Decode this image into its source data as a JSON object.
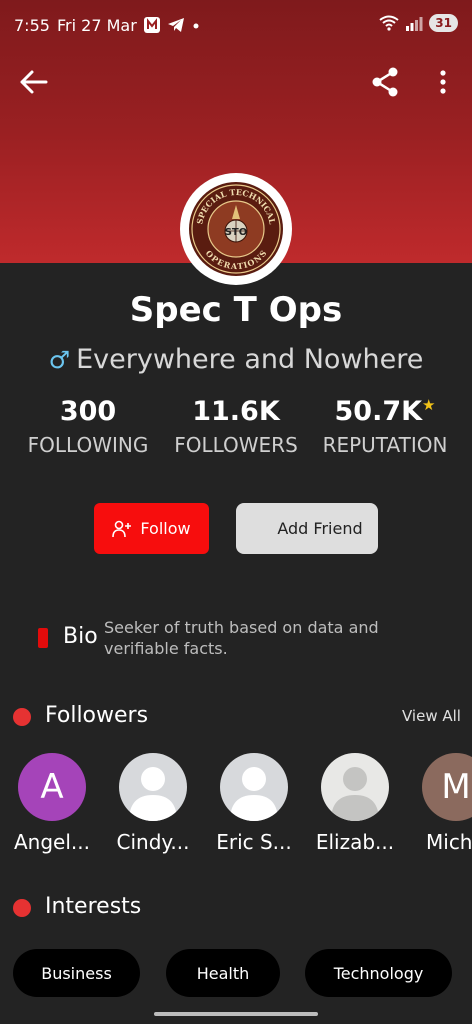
{
  "status_bar": {
    "time": "7:55",
    "date": "Fri 27 Mar",
    "battery": "31"
  },
  "header": {
    "back_icon": "arrow-left-icon",
    "share_icon": "share-icon",
    "more_icon": "more-vertical-icon"
  },
  "profile": {
    "logo_text_top": "SPECIAL TECHNICAL",
    "logo_text_bottom": "OPERATIONS",
    "logo_center": "STO",
    "name": "Spec T Ops",
    "gender_symbol": "♂",
    "location": "Everywhere and Nowhere"
  },
  "stats": [
    {
      "value": "300",
      "label": "FOLLOWING"
    },
    {
      "value": "11.6K",
      "label": "FOLLOWERS"
    },
    {
      "value": "50.7K",
      "label": "REPUTATION"
    }
  ],
  "actions": {
    "follow_label": "Follow",
    "add_friend_label": "Add Friend"
  },
  "bio": {
    "label": "Bio",
    "text": "Seeker of truth based on data and verifiable facts."
  },
  "followers_section": {
    "title": "Followers",
    "view_all": "View All",
    "items": [
      {
        "name": "Angel...",
        "initial": "A",
        "color": "#a544b9"
      },
      {
        "name": "Cindy...",
        "initial": "",
        "color": "#d7d9dc"
      },
      {
        "name": "Eric S...",
        "initial": "",
        "color": "#d7d9dc"
      },
      {
        "name": "Elizab...",
        "initial": "",
        "color": "#e8e8e6"
      },
      {
        "name": "Mich",
        "initial": "M",
        "color": "#8b6a5e"
      }
    ]
  },
  "interests_section": {
    "title": "Interests",
    "chips": [
      "Business",
      "Health",
      "Technology"
    ]
  },
  "colors": {
    "accent_red": "#f70d0d",
    "header_red": "#9a2022",
    "background": "#232323"
  }
}
